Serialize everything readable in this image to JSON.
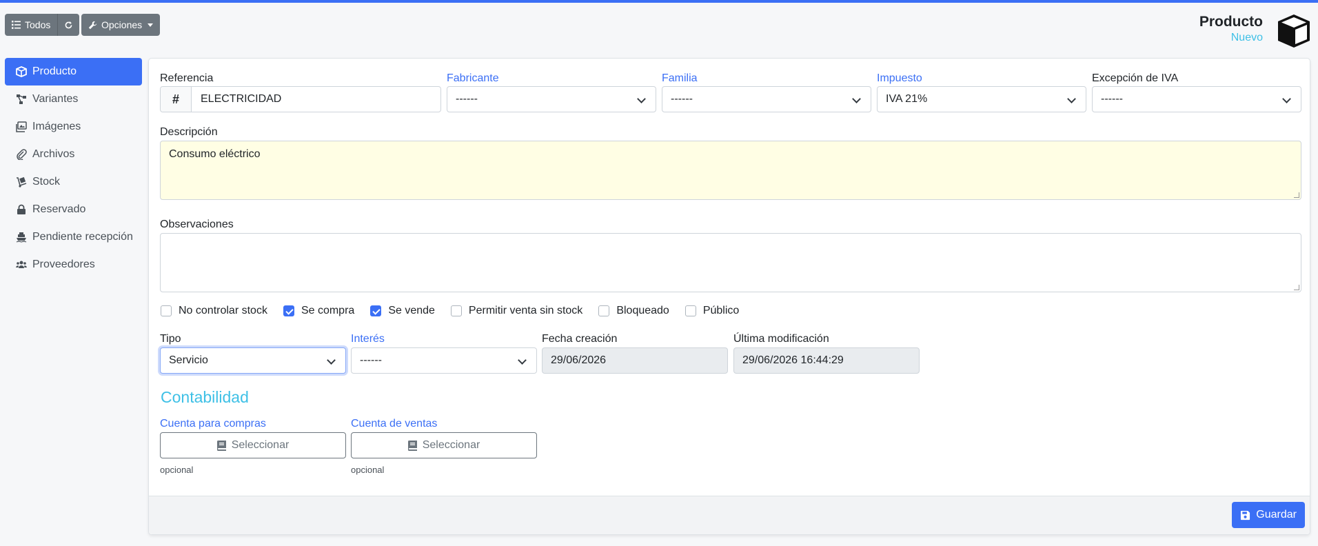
{
  "toolbar": {
    "todos_label": "Todos",
    "opciones_label": "Opciones"
  },
  "header": {
    "title": "Producto",
    "subtitle": "Nuevo"
  },
  "sidebar": {
    "items": [
      {
        "label": "Producto",
        "icon": "cube-icon",
        "active": true
      },
      {
        "label": "Variantes",
        "icon": "project-diagram-icon"
      },
      {
        "label": "Imágenes",
        "icon": "images-icon"
      },
      {
        "label": "Archivos",
        "icon": "paperclip-icon"
      },
      {
        "label": "Stock",
        "icon": "dolly-icon"
      },
      {
        "label": "Reservado",
        "icon": "lock-icon"
      },
      {
        "label": "Pendiente recepción",
        "icon": "ship-icon"
      },
      {
        "label": "Proveedores",
        "icon": "users-icon"
      }
    ]
  },
  "form": {
    "referencia": {
      "label": "Referencia",
      "prefix": "#",
      "value": "ELECTRICIDAD"
    },
    "fabricante": {
      "label": "Fabricante",
      "value": "------"
    },
    "familia": {
      "label": "Familia",
      "value": "------"
    },
    "impuesto": {
      "label": "Impuesto",
      "value": "IVA 21%"
    },
    "excepcion": {
      "label": "Excepción de IVA",
      "value": "------"
    },
    "descripcion": {
      "label": "Descripción",
      "value": "Consumo eléctrico"
    },
    "observaciones": {
      "label": "Observaciones",
      "value": ""
    },
    "checks": [
      {
        "label": "No controlar stock",
        "checked": false
      },
      {
        "label": "Se compra",
        "checked": true
      },
      {
        "label": "Se vende",
        "checked": true
      },
      {
        "label": "Permitir venta sin stock",
        "checked": false
      },
      {
        "label": "Bloqueado",
        "checked": false
      },
      {
        "label": "Público",
        "checked": false
      }
    ],
    "tipo": {
      "label": "Tipo",
      "value": "Servicio"
    },
    "interes": {
      "label": "Interés",
      "value": "------"
    },
    "fecha_creacion": {
      "label": "Fecha creación",
      "value": "29/06/2026"
    },
    "ultima_mod": {
      "label": "Última modificación",
      "value": "29/06/2026 16:44:29"
    }
  },
  "contabilidad": {
    "title": "Contabilidad",
    "compras": {
      "label": "Cuenta para compras",
      "button": "Seleccionar",
      "hint": "opcional"
    },
    "ventas": {
      "label": "Cuenta de ventas",
      "button": "Seleccionar",
      "hint": "opcional"
    }
  },
  "footer": {
    "save_label": "Guardar"
  },
  "colors": {
    "primary": "#3b6ff5",
    "info": "#3ec0e6",
    "secondary": "#6c757d",
    "description_bg": "#fffee4"
  }
}
